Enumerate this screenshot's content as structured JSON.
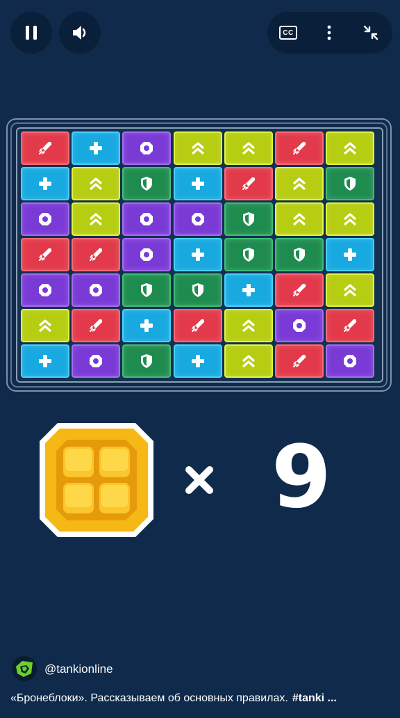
{
  "controls": {
    "pause_icon": "pause-icon",
    "volume_icon": "volume-icon",
    "captions_label": "CC",
    "more_icon": "more-vertical-icon",
    "exit_fullscreen_icon": "exit-fullscreen-icon"
  },
  "board": {
    "colors": {
      "red": {
        "fill": "#e23a4a",
        "border": "#ff6a76"
      },
      "blue": {
        "fill": "#17a9e0",
        "border": "#48d0ff"
      },
      "purple": {
        "fill": "#7a3ad6",
        "border": "#a56cf2"
      },
      "yellow": {
        "fill": "#b6cd12",
        "border": "#e3f540"
      },
      "green": {
        "fill": "#1f8c4f",
        "border": "#3fbd76"
      }
    },
    "rows": [
      [
        "rocket",
        "plus",
        "nut",
        "chevrons",
        "chevrons",
        "rocket",
        "chevrons"
      ],
      [
        "plus",
        "chevrons",
        "shield",
        "plus",
        "rocket",
        "chevrons",
        "shield"
      ],
      [
        "nut",
        "chevrons",
        "nut",
        "nut",
        "shield",
        "chevrons",
        "chevrons"
      ],
      [
        "rocket",
        "rocket",
        "nut",
        "plus",
        "shield",
        "shield",
        "plus"
      ],
      [
        "nut",
        "nut",
        "shield",
        "shield",
        "plus",
        "rocket",
        "chevrons"
      ],
      [
        "chevrons",
        "rocket",
        "plus",
        "rocket",
        "chevrons",
        "nut",
        "rocket"
      ],
      [
        "plus",
        "nut",
        "shield",
        "plus",
        "chevrons",
        "rocket",
        "nut"
      ]
    ]
  },
  "bonus": {
    "icon": "armor-block-icon",
    "multiplier_icon": "times-icon",
    "count": "9"
  },
  "channel": {
    "avatar_icon": "tanki-logo-icon",
    "handle": "@tankionline"
  },
  "caption": {
    "text": "«Бронеблоки». Рассказываем об основных правилах.",
    "hashtag": "#tanki ..."
  }
}
